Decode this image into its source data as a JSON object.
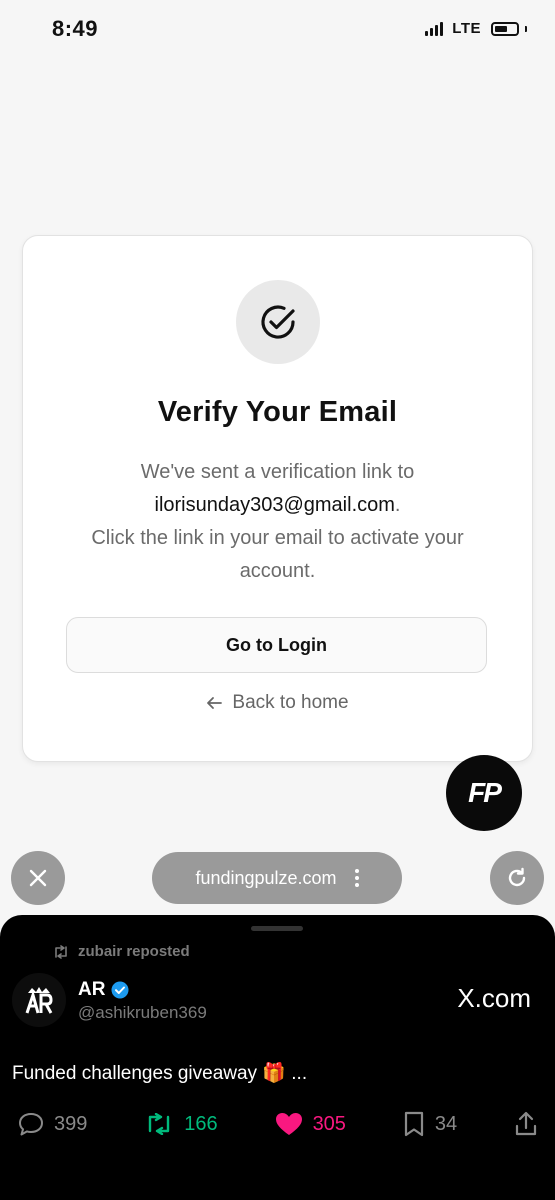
{
  "status_bar": {
    "time": "8:49",
    "network": "LTE"
  },
  "card": {
    "icon": "check-circle-icon",
    "title": "Verify Your Email",
    "message_line1": "We've sent a verification link to",
    "email": "ilorisunday303@gmail.com",
    "email_suffix": ".",
    "message_line2": "Click the link in your email to activate your account.",
    "login_button": "Go to Login",
    "back_link": "Back to home"
  },
  "fab": {
    "label": "FP"
  },
  "browser_bar": {
    "url": "fundingpulze.com"
  },
  "tweet": {
    "reposted_by": "zubair reposted",
    "author_name": "AR",
    "author_handle": "@ashikruben369",
    "site": "X.com",
    "text": "Funded challenges giveaway 🎁 ...",
    "replies": "399",
    "reposts": "166",
    "likes": "305",
    "bookmarks": "34"
  },
  "colors": {
    "repost": "#00ba7c",
    "like": "#f91880",
    "verified": "#1d9bf0",
    "url_pill": "#9a9a9a"
  }
}
